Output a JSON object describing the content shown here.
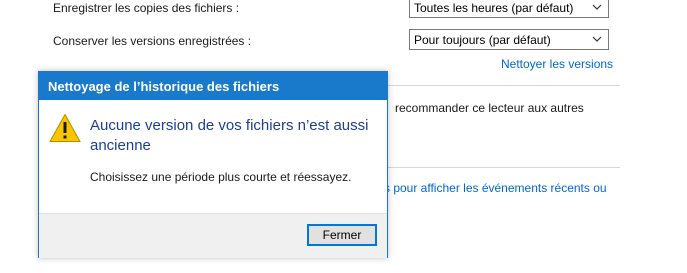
{
  "settings": {
    "save_copies_label": "Enregistrer les copies des fichiers :",
    "save_copies_value": "Toutes les heures (par défaut)",
    "keep_versions_label": "Conserver les versions enregistrées :",
    "keep_versions_value": "Pour toujours (par défaut)",
    "cleanup_link": "Nettoyer les versions",
    "recommend_text": "recommander ce lecteur aux autres",
    "events_link": "s pour afficher les événements récents ou"
  },
  "dialog": {
    "title": "Nettoyage de l’historique des fichiers",
    "main_instruction": "Aucune version de vos fichiers n’est aussi ancienne",
    "content": "Choisissez une période plus courte et réessayez.",
    "close_button": "Fermer",
    "icon": "warning-icon"
  },
  "colors": {
    "accent": "#1979ca",
    "link": "#0066cc",
    "instruction": "#1c3f94",
    "warning": "#f7c600"
  }
}
